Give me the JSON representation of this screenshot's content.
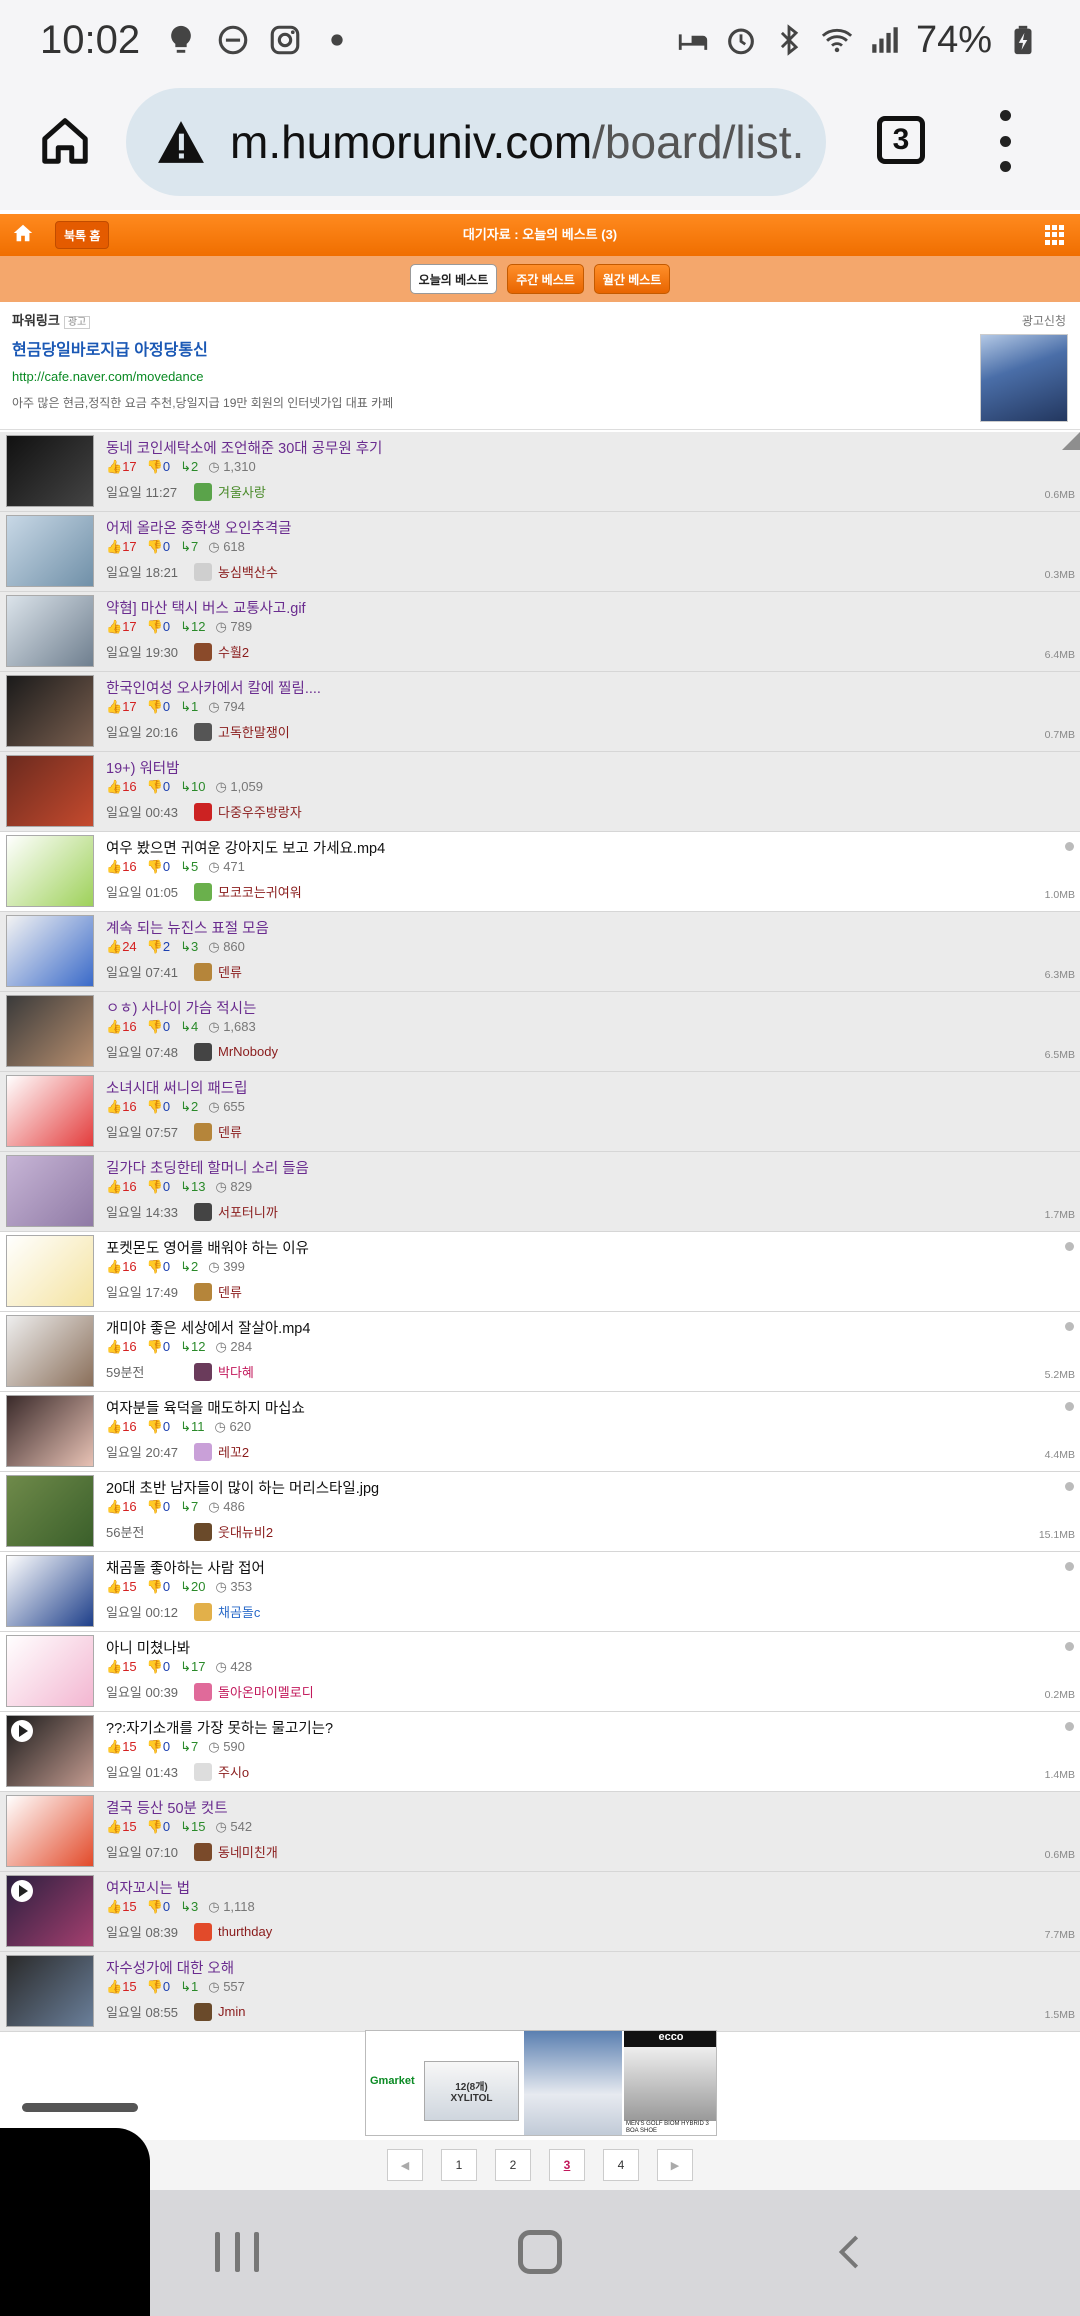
{
  "status_bar": {
    "time": "10:02",
    "battery": "74%"
  },
  "browser": {
    "url_host": "m.humoruniv.com",
    "url_path": "/board/list.",
    "tab_count": "3"
  },
  "site": {
    "bookmark_label": "북톡 홈",
    "title": "대기자료 : 오늘의 베스트 (3)",
    "subnav": [
      "오늘의 베스트",
      "주간 베스트",
      "월간 베스트"
    ]
  },
  "ad": {
    "powerlink": "파워링크",
    "ad_tag": "광고",
    "apply": "광고신청",
    "title": "현금당일바로지급 아정당통신",
    "link": "http://cafe.naver.com/movedance",
    "desc": "아주 많은 현금,정직한 요금 추천,당일지급 19만 회원의 인터넷가입 대표 카페"
  },
  "posts": [
    {
      "title": "동네 코인세탁소에 조언해준 30대 공무원 후기",
      "up": "17",
      "down": "0",
      "comments": "2",
      "views": "1,310",
      "date": "일요일 11:27",
      "nick": "겨울사랑",
      "size": "0.6MB",
      "style": "gray",
      "title_color": "purple"
    },
    {
      "title": "어제 올라온 중학생 오인추격글",
      "up": "17",
      "down": "0",
      "comments": "7",
      "views": "618",
      "date": "일요일 18:21",
      "nick": "농심백산수",
      "size": "0.3MB",
      "style": "gray",
      "title_color": "purple"
    },
    {
      "title": "약혐] 마산 택시 버스 교통사고.gif",
      "up": "17",
      "down": "0",
      "comments": "12",
      "views": "789",
      "date": "일요일 19:30",
      "nick": "수훨2",
      "size": "6.4MB",
      "style": "gray",
      "title_color": "purple"
    },
    {
      "title": "한국인여성 오사카에서 칼에 찔림....",
      "up": "17",
      "down": "0",
      "comments": "1",
      "views": "794",
      "date": "일요일 20:16",
      "nick": "고독한말쟁이",
      "size": "0.7MB",
      "style": "gray",
      "title_color": "purple"
    },
    {
      "title": "19+) 워터밤",
      "up": "16",
      "down": "0",
      "comments": "10",
      "views": "1,059",
      "date": "일요일 00:43",
      "nick": "다중우주방랑자",
      "size": "",
      "style": "gray",
      "title_color": "purple"
    },
    {
      "title": "여우 봤으면 귀여운 강아지도 보고 가세요.mp4",
      "up": "16",
      "down": "0",
      "comments": "5",
      "views": "471",
      "date": "일요일 01:05",
      "nick": "모코코는귀여워",
      "size": "1.0MB",
      "style": "white",
      "title_color": "black"
    },
    {
      "title": "계속 되는 뉴진스 표절 모음",
      "up": "24",
      "down": "2",
      "comments": "3",
      "views": "860",
      "date": "일요일 07:41",
      "nick": "덴류",
      "size": "6.3MB",
      "style": "gray",
      "title_color": "purple"
    },
    {
      "title": "ㅇㅎ) 사나이 가슴 적시는",
      "up": "16",
      "down": "0",
      "comments": "4",
      "views": "1,683",
      "date": "일요일 07:48",
      "nick": "MrNobody",
      "size": "6.5MB",
      "style": "gray",
      "title_color": "purple"
    },
    {
      "title": "소녀시대 써니의 패드립",
      "up": "16",
      "down": "0",
      "comments": "2",
      "views": "655",
      "date": "일요일 07:57",
      "nick": "덴류",
      "size": "",
      "style": "gray",
      "title_color": "purple"
    },
    {
      "title": "길가다 초딩한테 할머니 소리 들음",
      "up": "16",
      "down": "0",
      "comments": "13",
      "views": "829",
      "date": "일요일 14:33",
      "nick": "서포터니까",
      "size": "1.7MB",
      "style": "gray",
      "title_color": "purple"
    },
    {
      "title": "포켓몬도 영어를 배워야 하는 이유",
      "up": "16",
      "down": "0",
      "comments": "2",
      "views": "399",
      "date": "일요일 17:49",
      "nick": "덴류",
      "size": "",
      "style": "white",
      "title_color": "black"
    },
    {
      "title": "개미야 좋은 세상에서 잘살아.mp4",
      "up": "16",
      "down": "0",
      "comments": "12",
      "views": "284",
      "date": "59분전",
      "nick": "박다혜",
      "size": "5.2MB",
      "style": "white",
      "title_color": "black"
    },
    {
      "title": "여자분들 육덕을 매도하지 마십쇼",
      "up": "16",
      "down": "0",
      "comments": "11",
      "views": "620",
      "date": "일요일 20:47",
      "nick": "레꼬2",
      "size": "4.4MB",
      "style": "white",
      "title_color": "black"
    },
    {
      "title": "20대 초반 남자들이 많이 하는 머리스타일.jpg",
      "up": "16",
      "down": "0",
      "comments": "7",
      "views": "486",
      "date": "56분전",
      "nick": "웃대뉴비2",
      "size": "15.1MB",
      "style": "white",
      "title_color": "black"
    },
    {
      "title": "채곰돌 좋아하는 사람 접어",
      "up": "15",
      "down": "0",
      "comments": "20",
      "views": "353",
      "date": "일요일 00:12",
      "nick": "채곰돌c",
      "size": "",
      "style": "white",
      "title_color": "black"
    },
    {
      "title": "아니 미쳤나봐",
      "up": "15",
      "down": "0",
      "comments": "17",
      "views": "428",
      "date": "일요일 00:39",
      "nick": "돌아온마이멜로디",
      "size": "0.2MB",
      "style": "white",
      "title_color": "black"
    },
    {
      "title": "??:자기소개를 가장 못하는 물고기는?",
      "up": "15",
      "down": "0",
      "comments": "7",
      "views": "590",
      "date": "일요일 01:43",
      "nick": "주시o",
      "size": "1.4MB",
      "style": "white",
      "title_color": "black"
    },
    {
      "title": "결국 등산 50분 컷트",
      "up": "15",
      "down": "0",
      "comments": "15",
      "views": "542",
      "date": "일요일 07:10",
      "nick": "동네미친개",
      "size": "0.6MB",
      "style": "gray",
      "title_color": "purple"
    },
    {
      "title": "여자꼬시는 법",
      "up": "15",
      "down": "0",
      "comments": "3",
      "views": "1,118",
      "date": "일요일 08:39",
      "nick": "thurthday",
      "size": "7.7MB",
      "style": "gray",
      "title_color": "purple"
    },
    {
      "title": "자수성가에 대한 오해",
      "up": "15",
      "down": "0",
      "comments": "1",
      "views": "557",
      "date": "일요일 08:55",
      "nick": "Jmin",
      "size": "1.5MB",
      "style": "gray",
      "title_color": "purple"
    }
  ],
  "bottom_ad": {
    "brand": "Gmarket",
    "product": "XYLITOL",
    "badge": "12(8개)",
    "ecco": "ecco",
    "shoe_text": "MEN'S GOLF BIOM HYBRID 3 BOA SHOE"
  },
  "pagination": {
    "pages": [
      "1",
      "2",
      "3",
      "4"
    ],
    "current": "3",
    "prev": "◀",
    "next": "▶"
  }
}
